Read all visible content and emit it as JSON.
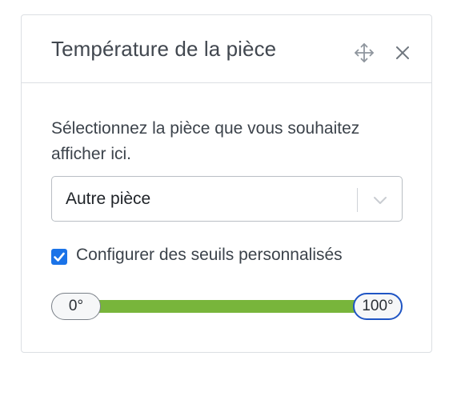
{
  "panel": {
    "title": "Température de la pièce",
    "header_icons": [
      "move-icon",
      "close-icon"
    ]
  },
  "content": {
    "description": "Sélectionnez la pièce que vous souhaitez afficher ici.",
    "room_select": {
      "value": "Autre pièce",
      "icon": "chevron-down-icon"
    },
    "custom_thresholds": {
      "checked": true,
      "label": "Configurer des seuils personnalisés"
    },
    "threshold_slider": {
      "min_label": "0°",
      "max_label": "100°",
      "min_value": 0,
      "max_value": 100,
      "range_min": 0,
      "range_max": 100,
      "fill_color": "#78b53b",
      "focus_color": "#1f55c4"
    }
  },
  "colors": {
    "checkbox": "#1a73e8",
    "border": "#dcdfe3"
  }
}
